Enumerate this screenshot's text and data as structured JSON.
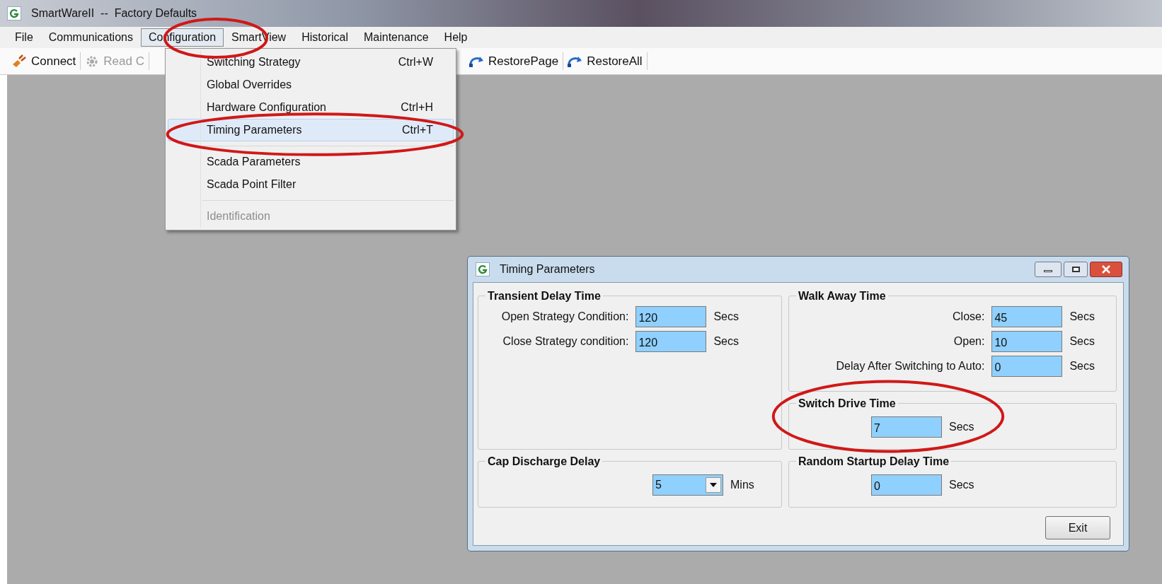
{
  "window": {
    "title": "SmartWareII  --  Factory Defaults"
  },
  "menu_bar": [
    {
      "label": "File",
      "selected": false
    },
    {
      "label": "Communications",
      "selected": false
    },
    {
      "label": "Configuration",
      "selected": true
    },
    {
      "label": "SmartView",
      "selected": false
    },
    {
      "label": "Historical",
      "selected": false
    },
    {
      "label": "Maintenance",
      "selected": false
    },
    {
      "label": "Help",
      "selected": false
    }
  ],
  "toolbar": [
    {
      "label": "Connect",
      "disabled": false
    },
    {
      "label": "Read C",
      "disabled": true
    },
    {
      "label": "RestorePage",
      "disabled": false
    },
    {
      "label": "RestoreAll",
      "disabled": false
    }
  ],
  "dropdown": [
    {
      "kind": "item",
      "label": "Switching Strategy",
      "shortcut": "Ctrl+W",
      "disabled": false,
      "selected": false
    },
    {
      "kind": "item",
      "label": "Global Overrides",
      "disabled": false,
      "selected": false
    },
    {
      "kind": "item",
      "label": "Hardware Configuration",
      "shortcut": "Ctrl+H",
      "disabled": false,
      "selected": false
    },
    {
      "kind": "item",
      "label": "Timing Parameters",
      "shortcut": "Ctrl+T",
      "disabled": false,
      "selected": true
    },
    {
      "kind": "separator"
    },
    {
      "kind": "item",
      "label": "Scada Parameters",
      "disabled": false,
      "selected": false
    },
    {
      "kind": "item",
      "label": "Scada Point Filter",
      "disabled": false,
      "selected": false
    },
    {
      "kind": "separator"
    },
    {
      "kind": "item",
      "label": "Identification",
      "disabled": true,
      "selected": false
    }
  ],
  "dialog": {
    "title": "Timing Parameters",
    "groups": [
      {
        "title": "Transient Delay Time",
        "fields": [
          {
            "kind": "text",
            "label": "Open Strategy Condition:",
            "value": "120",
            "unit": "Secs"
          },
          {
            "kind": "text",
            "label": "Close Strategy condition:",
            "value": "120",
            "unit": "Secs"
          }
        ]
      },
      {
        "title": "Walk Away Time",
        "fields": [
          {
            "kind": "text",
            "label": "Close:",
            "value": "45",
            "unit": "Secs"
          },
          {
            "kind": "text",
            "label": "Open:",
            "value": "10",
            "unit": "Secs"
          },
          {
            "kind": "text",
            "label": "Delay After Switching to Auto:",
            "value": "0",
            "unit": "Secs"
          }
        ]
      },
      {
        "title": "Switch Drive Time",
        "fields": [
          {
            "kind": "text",
            "value": "7",
            "unit": "Secs"
          }
        ]
      },
      {
        "title": "Cap Discharge Delay",
        "fields": [
          {
            "kind": "dropdown",
            "value": "5",
            "unit": "Mins"
          }
        ]
      },
      {
        "title": "Random Startup Delay Time",
        "fields": [
          {
            "kind": "text",
            "value": "0",
            "unit": "Secs"
          }
        ]
      }
    ],
    "button": "Exit"
  }
}
